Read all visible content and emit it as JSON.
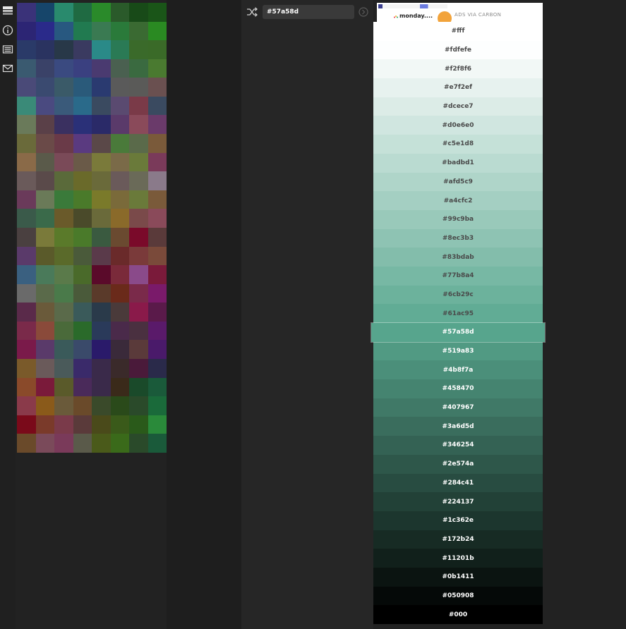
{
  "rail": {
    "icons": [
      {
        "name": "app-logo-icon"
      },
      {
        "name": "info-icon"
      },
      {
        "name": "news-icon"
      },
      {
        "name": "mail-icon"
      }
    ]
  },
  "palette": {
    "colors": [
      "#3a3279",
      "#16456a",
      "#298a6d",
      "#1f6a42",
      "#2a8a2a",
      "#2a5a2a",
      "#184a18",
      "#1a5518",
      "#2c2574",
      "#2a2a8a",
      "#285880",
      "#217a50",
      "#3a7a52",
      "#2a7a3a",
      "#3a6a32",
      "#2a8a22",
      "#2a3a68",
      "#2a3360",
      "#283848",
      "#3a3a60",
      "#2a8a88",
      "#2a7a55",
      "#3a6a2a",
      "#3a6a28",
      "#3a5a70",
      "#3a4268",
      "#3a4a80",
      "#3a4080",
      "#4a3a70",
      "#4a6050",
      "#3a6a40",
      "#4a7a30",
      "#4a4a78",
      "#3a4a70",
      "#3a5a68",
      "#2a5a7a",
      "#2a3a70",
      "#5a5a5a",
      "#5a5a58",
      "#6a5050",
      "#3a8a78",
      "#4a4a80",
      "#3a5a7a",
      "#2a6a8a",
      "#3a4a60",
      "#5a4a70",
      "#7a3a48",
      "#3a4a60",
      "#6a7a5a",
      "#5a4048",
      "#3a3060",
      "#2a3078",
      "#2a2a68",
      "#5a3a6a",
      "#8a4a5a",
      "#6a3a6a",
      "#6a6a3a",
      "#6a4a48",
      "#6a3a48",
      "#5a3a80",
      "#5a4848",
      "#4a7a3a",
      "#5a6a4a",
      "#7a5a3a",
      "#8a6a48",
      "#5a5a4a",
      "#7a4a58",
      "#6a5a48",
      "#7a7a3a",
      "#7a6a48",
      "#6a7a3a",
      "#7a3a5a",
      "#6a5a5a",
      "#5a4a4a",
      "#5a6a3a",
      "#6a6a2a",
      "#6a6a3a",
      "#6a5a5a",
      "#6a6a58",
      "#8a7a8a",
      "#6a3a5a",
      "#6a7a58",
      "#3a7a3a",
      "#4a7a2a",
      "#7a7a2a",
      "#7a6a3a",
      "#6a7a3a",
      "#7a5a3a",
      "#3a5a4a",
      "#3a6a4a",
      "#6a5a2a",
      "#4a4a2a",
      "#6a6a3a",
      "#8a6a2a",
      "#7a4a4a",
      "#8a4a5a",
      "#4a4040",
      "#7a7a3a",
      "#5a7a2a",
      "#4a7a2a",
      "#3a5a40",
      "#6a4a30",
      "#7a0a2a",
      "#5a3a3a",
      "#5a3a6a",
      "#5a5a2a",
      "#5a6a2a",
      "#4a5a3a",
      "#5a3a4a",
      "#6a2a2a",
      "#7a3a3a",
      "#7a4a3a",
      "#3a6080",
      "#4a7a5a",
      "#5a7a4a",
      "#4a6a2a",
      "#5a0a2a",
      "#7a2a3a",
      "#8a4a8a",
      "#7a1a3a",
      "#6a6a6a",
      "#5a6a4a",
      "#4a7a4a",
      "#4a5a3a",
      "#5a3a2a",
      "#6a2a1a",
      "#7a2a4a",
      "#7a1a6a",
      "#5a2a4a",
      "#6a5a3a",
      "#5a6a4a",
      "#3a5a5a",
      "#2a3a4a",
      "#4a3a3a",
      "#8a1a4a",
      "#5a1a4a",
      "#7a2a4a",
      "#8a4a3a",
      "#4a6a3a",
      "#2a6a2a",
      "#2a3a5a",
      "#4a2a4a",
      "#4a3040",
      "#5a1a6a",
      "#7a1a4a",
      "#5a3a6a",
      "#3a5a5a",
      "#3a4a6a",
      "#2a1a6a",
      "#3a2a3a",
      "#5a3a3a",
      "#4a1a6a",
      "#7a5a2a",
      "#6a5a5a",
      "#4a5a5a",
      "#3a2a6a",
      "#3a2a4a",
      "#3a2a2a",
      "#4a1a3a",
      "#2a2a4a",
      "#8a4a2a",
      "#7a1a3a",
      "#5a5a2a",
      "#4a2a5a",
      "#3a2a4a",
      "#3a2a1a",
      "#1a4a2a",
      "#1a5a3a",
      "#8a3a4a",
      "#8a5a1a",
      "#6a5a3a",
      "#6a4a2a",
      "#3a4a2a",
      "#2a4a1a",
      "#2a4a2a",
      "#1a6a3a",
      "#7a0a1a",
      "#7a3a2a",
      "#7a3a4a",
      "#5a3a3a",
      "#4a4a1a",
      "#3a5a1a",
      "#2a5a1a",
      "#2a8a3a",
      "#6a4a2a",
      "#7a4a5a",
      "#7a3a5a",
      "#5a5a4a",
      "#4a5a1a",
      "#3a6a1a",
      "#2a4a2a",
      "#1a5a3a"
    ]
  },
  "toolbar": {
    "hex_value": "#57a58d"
  },
  "ad": {
    "logo_text": "monday....",
    "label": "ADS VIA CARBON"
  },
  "shades": [
    {
      "hex": "#fff",
      "selected": false
    },
    {
      "hex": "#fdfefe",
      "selected": false
    },
    {
      "hex": "#f2f8f6",
      "selected": false
    },
    {
      "hex": "#e7f2ef",
      "selected": false
    },
    {
      "hex": "#dcece7",
      "selected": false
    },
    {
      "hex": "#d0e6e0",
      "selected": false
    },
    {
      "hex": "#c5e1d8",
      "selected": false
    },
    {
      "hex": "#badbd1",
      "selected": false
    },
    {
      "hex": "#afd5c9",
      "selected": false
    },
    {
      "hex": "#a4cfc2",
      "selected": false
    },
    {
      "hex": "#99c9ba",
      "selected": false
    },
    {
      "hex": "#8ec3b3",
      "selected": false
    },
    {
      "hex": "#83bdab",
      "selected": false
    },
    {
      "hex": "#77b8a4",
      "selected": false
    },
    {
      "hex": "#6cb29c",
      "selected": false
    },
    {
      "hex": "#61ac95",
      "selected": false
    },
    {
      "hex": "#57a58d",
      "selected": true
    },
    {
      "hex": "#519a83",
      "selected": false
    },
    {
      "hex": "#4b8f7a",
      "selected": false
    },
    {
      "hex": "#458470",
      "selected": false
    },
    {
      "hex": "#407967",
      "selected": false
    },
    {
      "hex": "#3a6d5d",
      "selected": false
    },
    {
      "hex": "#346254",
      "selected": false
    },
    {
      "hex": "#2e574a",
      "selected": false
    },
    {
      "hex": "#284c41",
      "selected": false
    },
    {
      "hex": "#224137",
      "selected": false
    },
    {
      "hex": "#1c362e",
      "selected": false
    },
    {
      "hex": "#172b24",
      "selected": false
    },
    {
      "hex": "#11201b",
      "selected": false
    },
    {
      "hex": "#0b1411",
      "selected": false
    },
    {
      "hex": "#050908",
      "selected": false
    },
    {
      "hex": "#000",
      "selected": false
    }
  ],
  "colors": {
    "app_bg": "#222222",
    "input_bg": "#3a3a3a",
    "ad_accent": "#f2a33a"
  }
}
